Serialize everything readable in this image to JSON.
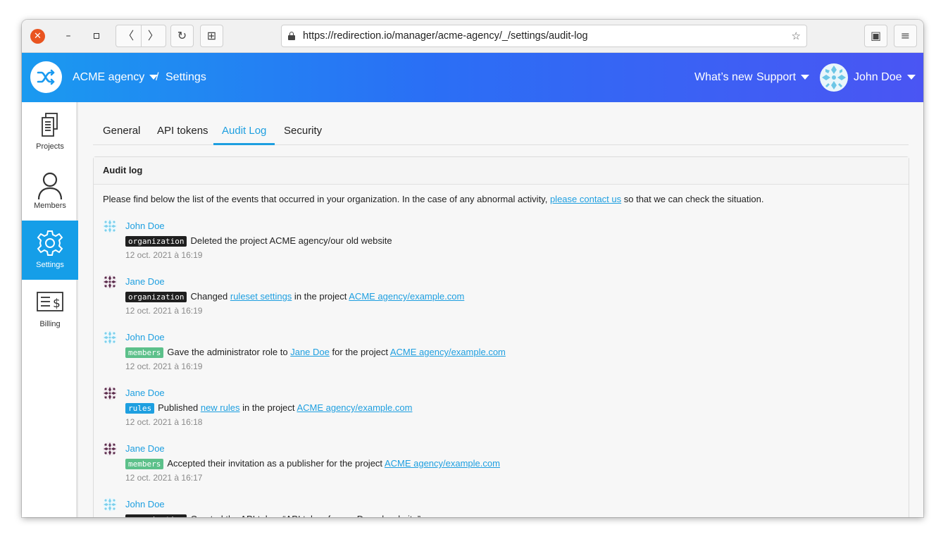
{
  "browser": {
    "url": "https://redirection.io/manager/acme-agency/_/settings/audit-log",
    "back_label": "〈",
    "forward_label": "〉",
    "reload_label": "↻",
    "newtab_label": "⊞",
    "close_label": "✕",
    "minimize_label": "–",
    "bookmark_label": "☆",
    "menu_label": "≡",
    "container_label": "▣"
  },
  "header": {
    "org_name": "ACME agency",
    "separator": "/",
    "breadcrumb": "Settings",
    "whats_new": "What’s new",
    "support": "Support",
    "user_name": "John Doe"
  },
  "sidebar": {
    "items": [
      {
        "label": "Projects",
        "icon": "projects-icon"
      },
      {
        "label": "Members",
        "icon": "members-icon"
      },
      {
        "label": "Settings",
        "icon": "settings-icon",
        "active": true
      },
      {
        "label": "Billing",
        "icon": "billing-icon"
      }
    ]
  },
  "tabs": [
    {
      "label": "General"
    },
    {
      "label": "API tokens"
    },
    {
      "label": "Audit Log",
      "active": true
    },
    {
      "label": "Security"
    }
  ],
  "panel": {
    "title": "Audit log",
    "intro_before": "Please find below the list of the events that occurred in your organization. In the case of any abnormal activity, ",
    "intro_link": "please contact us",
    "intro_after": " so that we can check the situation."
  },
  "events": [
    {
      "user": "John Doe",
      "avatar": "john",
      "tag": "organization",
      "parts": [
        {
          "t": "Deleted the project ACME agency/our old website"
        }
      ],
      "date": "12 oct. 2021 à 16:19"
    },
    {
      "user": "Jane Doe",
      "avatar": "jane",
      "tag": "organization",
      "parts": [
        {
          "t": "Changed "
        },
        {
          "t": "ruleset settings",
          "link": true
        },
        {
          "t": " in the project "
        },
        {
          "t": "ACME agency/example.com",
          "link": true
        }
      ],
      "date": "12 oct. 2021 à 16:19"
    },
    {
      "user": "John Doe",
      "avatar": "john",
      "tag": "members",
      "parts": [
        {
          "t": "Gave the administrator role to "
        },
        {
          "t": "Jane Doe",
          "link": true
        },
        {
          "t": " for the project "
        },
        {
          "t": "ACME agency/example.com",
          "link": true
        }
      ],
      "date": "12 oct. 2021 à 16:19"
    },
    {
      "user": "Jane Doe",
      "avatar": "jane",
      "tag": "rules",
      "parts": [
        {
          "t": "Published "
        },
        {
          "t": "new rules",
          "link": true
        },
        {
          "t": " in the project "
        },
        {
          "t": "ACME agency/example.com",
          "link": true
        }
      ],
      "date": "12 oct. 2021 à 16:18"
    },
    {
      "user": "Jane Doe",
      "avatar": "jane",
      "tag": "members",
      "parts": [
        {
          "t": "Accepted their invitation as a publisher for the project "
        },
        {
          "t": "ACME agency/example.com",
          "link": true
        }
      ],
      "date": "12 oct. 2021 à 16:17"
    },
    {
      "user": "John Doe",
      "avatar": "john",
      "tag": "organization",
      "parts": [
        {
          "t": "Created the API token “API token for our Drupal website”"
        }
      ],
      "date": ""
    }
  ],
  "colors": {
    "accent": "#1e9fe0",
    "sidebar_active": "#159ee8",
    "tag_organization": "#1f1f1f",
    "tag_members": "#5cc08a",
    "tag_rules": "#1e9fe0"
  }
}
